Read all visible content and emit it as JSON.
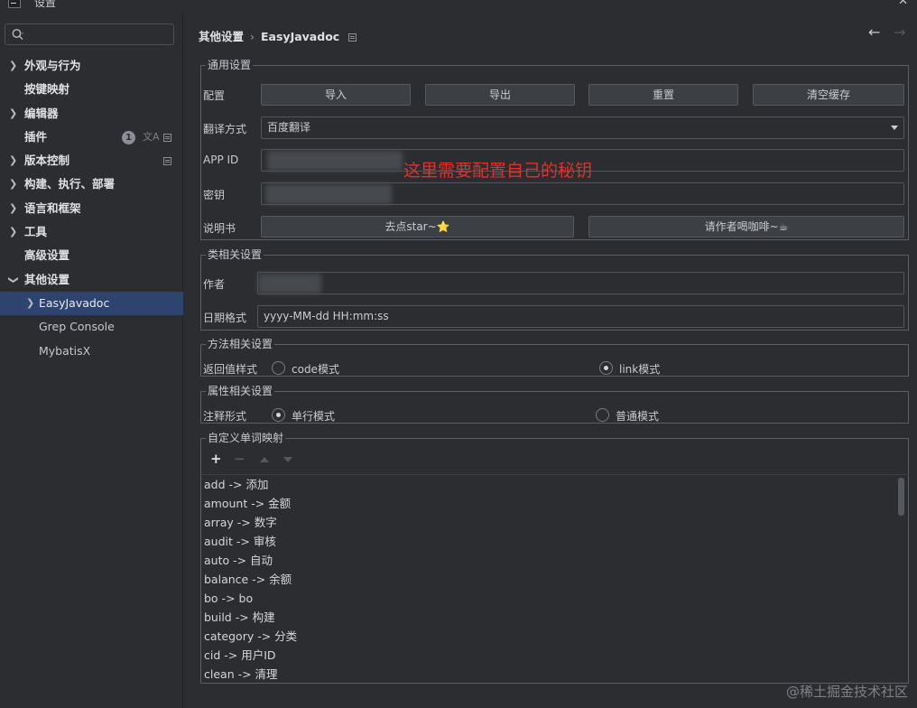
{
  "window": {
    "title": "设置",
    "close_glyph": "✕"
  },
  "sidebar": {
    "search_placeholder": "",
    "items": [
      {
        "label": "外观与行为",
        "expandable": true
      },
      {
        "label": "按键映射",
        "expandable": false
      },
      {
        "label": "编辑器",
        "expandable": true
      },
      {
        "label": "插件",
        "expandable": false,
        "badge": "1"
      },
      {
        "label": "版本控制",
        "expandable": true
      },
      {
        "label": "构建、执行、部署",
        "expandable": true
      },
      {
        "label": "语言和框架",
        "expandable": true
      },
      {
        "label": "工具",
        "expandable": true
      },
      {
        "label": "高级设置",
        "expandable": false
      },
      {
        "label": "其他设置",
        "expandable": true,
        "expanded": true
      },
      {
        "label": "EasyJavadoc",
        "expandable": true,
        "selected": true
      },
      {
        "label": "Grep Console",
        "expandable": false
      },
      {
        "label": "MybatisX",
        "expandable": false
      }
    ]
  },
  "breadcrumb": {
    "parent": "其他设置",
    "separator": "›",
    "current": "EasyJavadoc"
  },
  "general": {
    "legend": "通用设置",
    "config_label": "配置",
    "buttons": {
      "import": "导入",
      "export": "导出",
      "reset": "重置",
      "clear_cache": "清空缓存"
    },
    "translate_label": "翻译方式",
    "translate_value": "百度翻译",
    "appid_label": "APP ID",
    "secret_label": "密钥",
    "annotation": "这里需要配置自己的秘钥",
    "manual_label": "说明书",
    "star_button": "去点star~⭐",
    "coffee_button": "请作者喝咖啡~☕"
  },
  "class_settings": {
    "legend": "类相关设置",
    "author_label": "作者",
    "date_label": "日期格式",
    "date_value": "yyyy-MM-dd HH:mm:ss"
  },
  "method_settings": {
    "legend": "方法相关设置",
    "return_label": "返回值样式",
    "options": [
      "code模式",
      "link模式"
    ],
    "selected_index": 1
  },
  "field_settings": {
    "legend": "属性相关设置",
    "comment_label": "注释形式",
    "options": [
      "单行模式",
      "普通模式"
    ],
    "selected_index": 0
  },
  "word_mapping": {
    "legend": "自定义单词映射",
    "items": [
      "add -> 添加",
      "amount -> 金额",
      "array -> 数字",
      "audit -> 审核",
      "auto -> 自动",
      "balance -> 余额",
      "bo -> bo",
      "build -> 构建",
      "category -> 分类",
      "cid -> 用户ID",
      "clean -> 清理"
    ]
  },
  "watermark": "@稀土掘金技术社区"
}
